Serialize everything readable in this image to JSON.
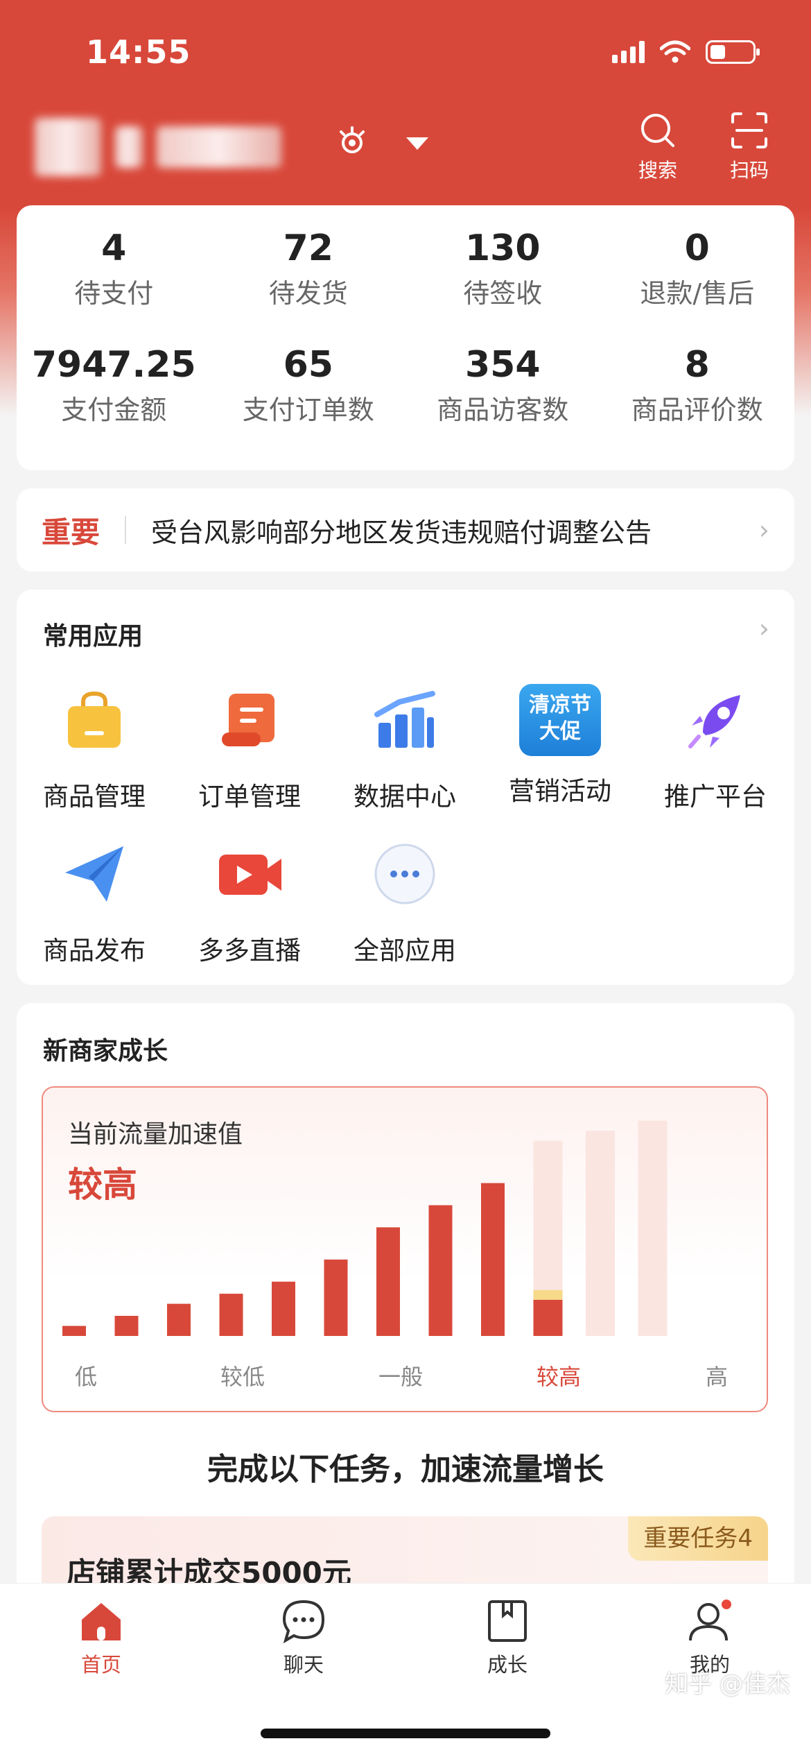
{
  "status_bar": {
    "time": "14:55",
    "battery_level": 0.35
  },
  "header": {
    "search_label": "搜索",
    "scan_label": "扫码"
  },
  "stats": [
    {
      "value": "4",
      "label": "待支付"
    },
    {
      "value": "72",
      "label": "待发货"
    },
    {
      "value": "130",
      "label": "待签收"
    },
    {
      "value": "0",
      "label": "退款/售后"
    },
    {
      "value": "7947.25",
      "label": "支付金额"
    },
    {
      "value": "65",
      "label": "支付订单数"
    },
    {
      "value": "354",
      "label": "商品访客数"
    },
    {
      "value": "8",
      "label": "商品评价数"
    }
  ],
  "notice": {
    "tag": "重要",
    "text": "受台风影响部分地区发货违规赔付调整公告"
  },
  "apps": {
    "title": "常用应用",
    "items": [
      {
        "label": "商品管理",
        "icon": "shopping-bag-icon"
      },
      {
        "label": "订单管理",
        "icon": "order-scroll-icon"
      },
      {
        "label": "数据中心",
        "icon": "bar-chart-icon"
      },
      {
        "label": "营销活动",
        "icon": "promo-badge-icon",
        "badge_text_1": "清凉节",
        "badge_text_2": "大促"
      },
      {
        "label": "推广平台",
        "icon": "rocket-icon"
      },
      {
        "label": "商品发布",
        "icon": "paper-plane-icon"
      },
      {
        "label": "多多直播",
        "icon": "live-video-icon"
      },
      {
        "label": "全部应用",
        "icon": "more-dots-icon"
      }
    ]
  },
  "growth": {
    "title": "新商家成长",
    "traffic_title": "当前流量加速值",
    "traffic_level": "较高",
    "axis_labels": [
      "低",
      "较低",
      "一般",
      "较高",
      "高"
    ],
    "active_axis_index": 3,
    "bar_levels": [
      0.05,
      0.1,
      0.16,
      0.21,
      0.27,
      0.38,
      0.54,
      0.65,
      0.76,
      0.87
    ],
    "pending_bar_levels": [
      0.97,
      1.02,
      1.07
    ],
    "pending_first_progress": 0.18,
    "colors": {
      "accent": "#d8483a",
      "pending": "#fbe5e1"
    },
    "task_heading": "完成以下任务，加速流量增长",
    "task_badge": "重要任务4",
    "task_title": "店铺累计成交5000元"
  },
  "tabbar": {
    "items": [
      {
        "label": "首页",
        "active": true
      },
      {
        "label": "聊天",
        "active": false
      },
      {
        "label": "成长",
        "active": false
      },
      {
        "label": "我的",
        "active": false
      }
    ]
  },
  "watermark": "知乎 @佳杰"
}
